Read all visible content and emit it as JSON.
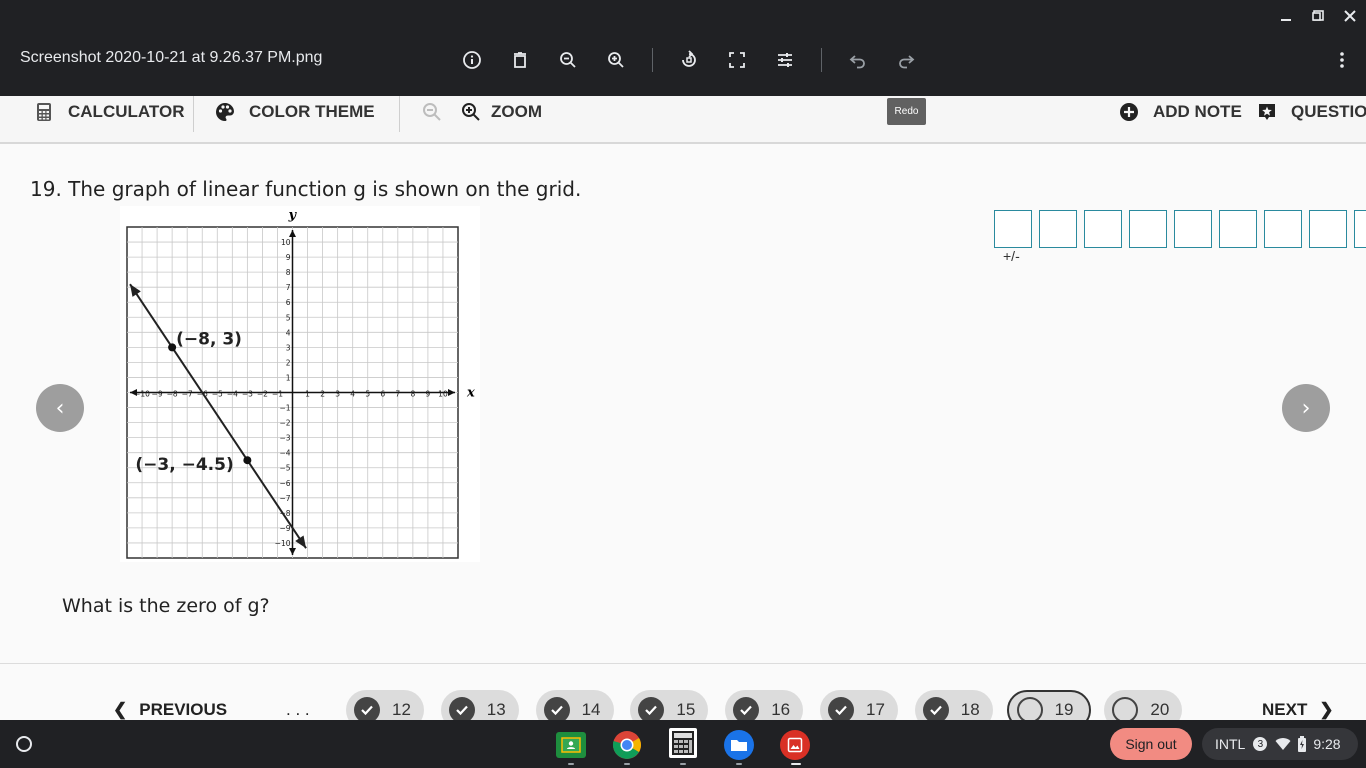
{
  "viewer": {
    "file_name": "Screenshot 2020-10-21 at 9.26.37 PM.png",
    "tooltip": "Redo"
  },
  "toolbar": {
    "calculator": "CALCULATOR",
    "color_theme": "COLOR THEME",
    "zoom": "ZOOM",
    "add_note": "ADD NOTE",
    "question": "QUESTION"
  },
  "question": {
    "stem": "19. The graph of linear function g is shown on the grid.",
    "prompt": "What is the zero of g?",
    "answer_sign_label": "+/-",
    "answer_box_count": 9
  },
  "graph": {
    "x_axis_label": "x",
    "y_axis_label": "y",
    "x_ticks": [
      "−10",
      "−9",
      "−8",
      "−7",
      "−6",
      "−5",
      "−4",
      "−3",
      "−2",
      "−1",
      "1",
      "2",
      "3",
      "4",
      "5",
      "6",
      "7",
      "8",
      "9",
      "10"
    ],
    "y_ticks": [
      "10",
      "9",
      "8",
      "7",
      "6",
      "5",
      "4",
      "3",
      "2",
      "1",
      "−1",
      "−2",
      "−3",
      "−4",
      "−5",
      "−6",
      "−7",
      "−8",
      "−9",
      "−10"
    ],
    "points": [
      {
        "label": "(−8, 3)",
        "x": -8,
        "y": 3
      },
      {
        "label": "(−3, −4.5)",
        "x": -3,
        "y": -4.5
      }
    ]
  },
  "nav": {
    "previous": "PREVIOUS",
    "ellipsis": ". . .",
    "next": "NEXT",
    "questions": [
      {
        "num": "12",
        "done": true
      },
      {
        "num": "13",
        "done": true
      },
      {
        "num": "14",
        "done": true
      },
      {
        "num": "15",
        "done": true
      },
      {
        "num": "16",
        "done": true
      },
      {
        "num": "17",
        "done": true
      },
      {
        "num": "18",
        "done": true
      },
      {
        "num": "19",
        "done": false,
        "current": true
      },
      {
        "num": "20",
        "done": false
      }
    ]
  },
  "shelf": {
    "sign_out": "Sign out",
    "input_method": "INTL",
    "notifications": "3",
    "time": "9:28",
    "apps": [
      "google-classroom",
      "chrome",
      "calculator-app",
      "files",
      "gallery"
    ]
  }
}
